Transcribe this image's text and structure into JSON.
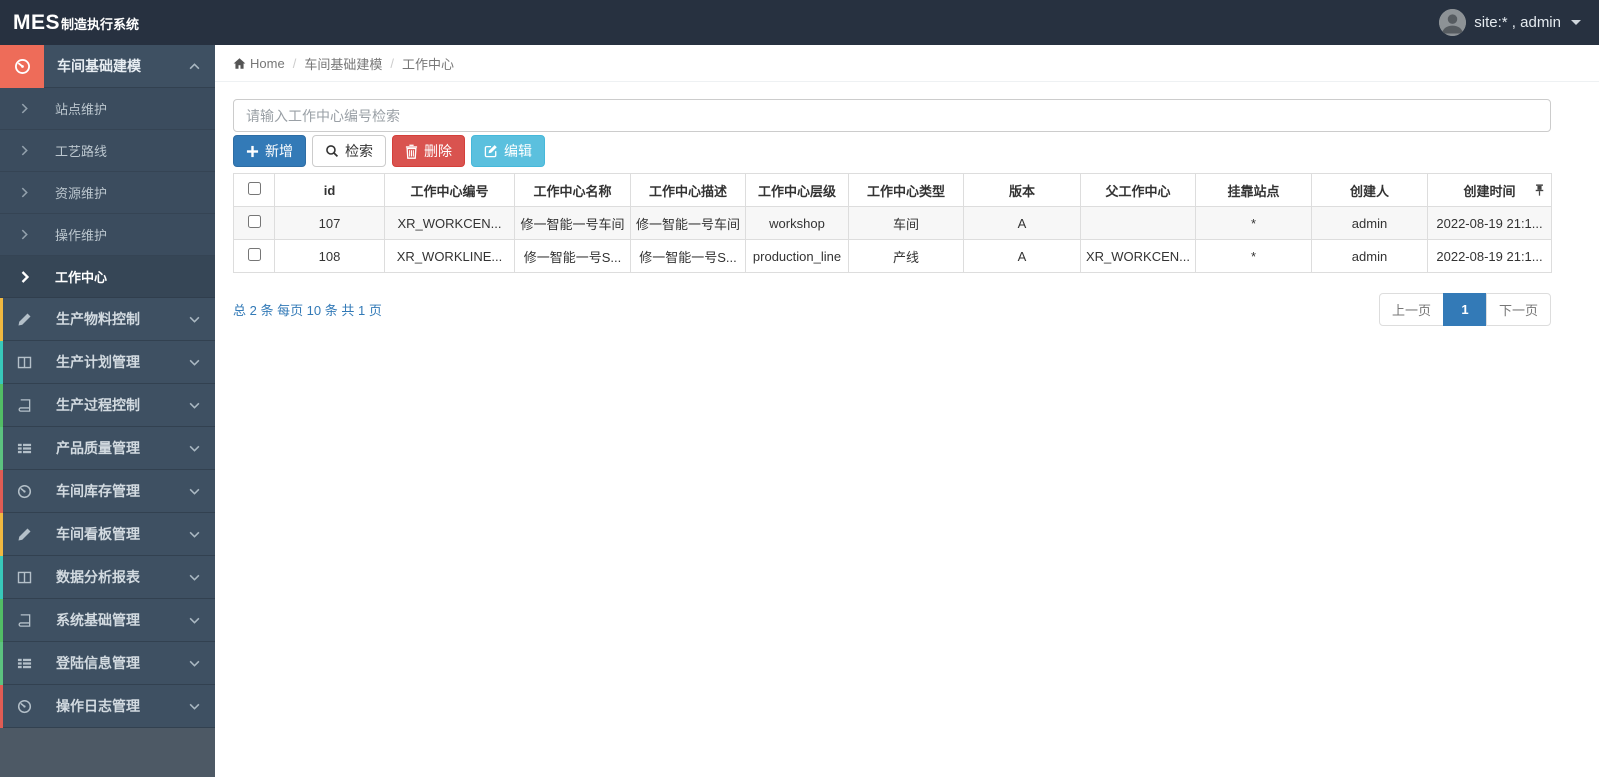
{
  "navbar": {
    "brand_bold": "MES",
    "brand_text": "制造执行系统",
    "user_label": "site:* , admin"
  },
  "breadcrumb": {
    "home_label": "Home",
    "sep": "/",
    "parent": "车间基础建模",
    "current": "工作中心"
  },
  "sidebar": {
    "active_group": {
      "label": "车间基础建模",
      "icon": "tachometer-icon"
    },
    "submenu": [
      {
        "label": "站点维护"
      },
      {
        "label": "工艺路线"
      },
      {
        "label": "资源维护"
      },
      {
        "label": "操作维护"
      },
      {
        "label": "工作中心"
      }
    ],
    "groups": [
      {
        "label": "生产物料控制",
        "icon": "pencil-icon",
        "strip_color": "#f0b840"
      },
      {
        "label": "生产计划管理",
        "icon": "columns-icon",
        "strip_color": "#38c8ba"
      },
      {
        "label": "生产过程控制",
        "icon": "book-icon",
        "strip_color": "#52bd65"
      },
      {
        "label": "产品质量管理",
        "icon": "list-icon",
        "strip_color": "#5cc27f"
      },
      {
        "label": "车间库存管理",
        "icon": "tachometer-icon",
        "strip_color": "#e05c54"
      },
      {
        "label": "车间看板管理",
        "icon": "pencil-icon",
        "strip_color": "#f0b840"
      },
      {
        "label": "数据分析报表",
        "icon": "columns-icon",
        "strip_color": "#38c8ba"
      },
      {
        "label": "系统基础管理",
        "icon": "book-icon",
        "strip_color": "#52bd65"
      },
      {
        "label": "登陆信息管理",
        "icon": "list-icon",
        "strip_color": "#5cc27f"
      },
      {
        "label": "操作日志管理",
        "icon": "tachometer-icon",
        "strip_color": "#e05c54"
      }
    ]
  },
  "toolbar": {
    "search_placeholder": "请输入工作中心编号检索",
    "add_label": "新增",
    "query_label": "检索",
    "delete_label": "删除",
    "edit_label": "编辑"
  },
  "table": {
    "columns": [
      "id",
      "工作中心编号",
      "工作中心名称",
      "工作中心描述",
      "工作中心层级",
      "工作中心类型",
      "版本",
      "父工作中心",
      "挂靠站点",
      "创建人",
      "创建时间"
    ],
    "rows": [
      [
        "107",
        "XR_WORKCEN...",
        "修一智能一号车间",
        "修一智能一号车间",
        "workshop",
        "车间",
        "A",
        "",
        "*",
        "admin",
        "2022-08-19 21:1..."
      ],
      [
        "108",
        "XR_WORKLINE...",
        "修一智能一号S...",
        "修一智能一号S...",
        "production_line",
        "产线",
        "A",
        "XR_WORKCEN...",
        "*",
        "admin",
        "2022-08-19 21:1..."
      ]
    ]
  },
  "footer": {
    "summary": "总 2 条  每页 10 条  共 1 页",
    "prev_label": "上一页",
    "page": "1",
    "next_label": "下一页"
  },
  "colors": {
    "navbar_bg": "#273140",
    "sidebar_row_bg": "#3e5062",
    "active_icon_bg": "#ee6c59",
    "primary": "#337ab7",
    "danger": "#d9534f",
    "info": "#5bc0de"
  }
}
